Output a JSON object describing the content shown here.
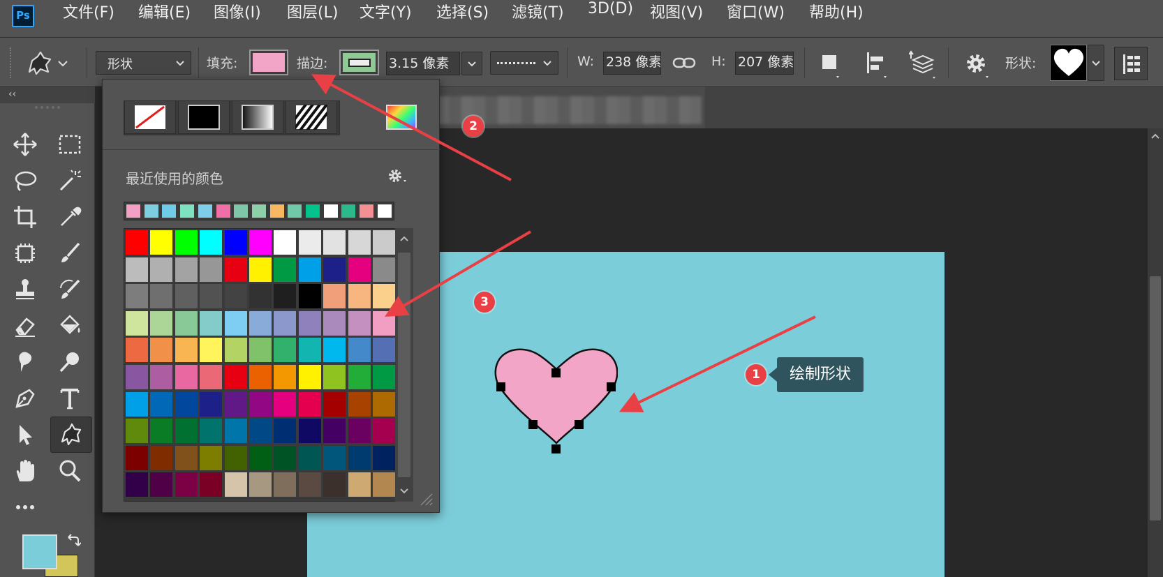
{
  "app": {
    "logo_text": "Ps"
  },
  "menu": [
    "文件(F)",
    "编辑(E)",
    "图像(I)",
    "图层(L)",
    "文字(Y)",
    "选择(S)",
    "滤镜(T)",
    "3D(D)",
    "视图(V)",
    "窗口(W)",
    "帮助(H)"
  ],
  "options": {
    "mode_value": "形状",
    "fill_label": "填充:",
    "fill_color": "#f2a5c6",
    "stroke_label": "描边:",
    "stroke_color": "#8fc995",
    "stroke_width": "3.15 像素",
    "w_label": "W:",
    "w_value": "238 像素",
    "h_label": "H:",
    "h_value": "207 像素",
    "shape_label": "形状:"
  },
  "panel": {
    "recent_label": "最近使用的颜色",
    "recent_colors": [
      "#f4a0c4",
      "#7dcfe0",
      "#6fcbe8",
      "#7ee1bf",
      "#80cdea",
      "#ef6fa6",
      "#80c6a8",
      "#8ccfa8",
      "#f7b861",
      "#72c9a9",
      "#00c48c",
      "#ffffff",
      "#2cb98b",
      "#f48f93",
      "#ffffff"
    ],
    "swatches": [
      [
        "#ff0000",
        "#ffff00",
        "#00ff00",
        "#00ffff",
        "#0000ff",
        "#ff00ff",
        "#ffffff",
        "#ebebeb",
        "#e2e2e2",
        "#d7d7d7",
        "#cbcbcb"
      ],
      [
        "#bcbcbc",
        "#b0b0b0",
        "#a3a3a3",
        "#979797",
        "#e60012",
        "#fff100",
        "#009944",
        "#00a0e9",
        "#1d2088",
        "#e4007f",
        "#8a8a8a"
      ],
      [
        "#7d7d7d",
        "#6f6f6f",
        "#606060",
        "#525252",
        "#434343",
        "#323232",
        "#1f1f1f",
        "#000000",
        "#f19f7a",
        "#f7b680",
        "#fbcf8c"
      ],
      [
        "#cfe59e",
        "#acd598",
        "#89c997",
        "#84ccc9",
        "#7ecef4",
        "#89abda",
        "#8c97cb",
        "#8f82bc",
        "#aa89bd",
        "#c490bf",
        "#f29ec2"
      ],
      [
        "#ec6941",
        "#f19149",
        "#f8b551",
        "#fff45c",
        "#b3d465",
        "#80c269",
        "#32b16c",
        "#13b5b1",
        "#00b7ee",
        "#448aca",
        "#556fb5"
      ],
      [
        "#8957a1",
        "#ad5da1",
        "#ea68a2",
        "#eb6877",
        "#e60012",
        "#eb6100",
        "#f39800",
        "#fff100",
        "#8fc31f",
        "#22ac38",
        "#009944"
      ],
      [
        "#00a0e9",
        "#0068b7",
        "#00479d",
        "#1d2088",
        "#601986",
        "#920783",
        "#e4007f",
        "#e5004f",
        "#a40000",
        "#a84200",
        "#ac6a00"
      ],
      [
        "#5f8a0b",
        "#097c25",
        "#007130",
        "#00736d",
        "#0075a9",
        "#004986",
        "#002e73",
        "#100964",
        "#440062",
        "#6a005f",
        "#a4004f"
      ],
      [
        "#7d0000",
        "#7f2d00",
        "#81511c",
        "#7d7d00",
        "#426202",
        "#005e15",
        "#005325",
        "#005652",
        "#00577b",
        "#003b6f",
        "#00225e"
      ],
      [
        "#310049",
        "#500047",
        "#7b0044",
        "#7a0026",
        "#d5c4a9",
        "#a69881",
        "#806e5d",
        "#5a4a41",
        "#3b302b",
        "#cfa972",
        "#b28850"
      ]
    ]
  },
  "annotations": {
    "n1": "1",
    "n2": "2",
    "n3": "3",
    "tooltip": "绘制形状"
  },
  "colors": {
    "canvas": "#7ccdda",
    "heart": "#f2a5c6",
    "foreground": "#7ccdda",
    "background": "#d2c55a",
    "arrow": "#e84044"
  }
}
